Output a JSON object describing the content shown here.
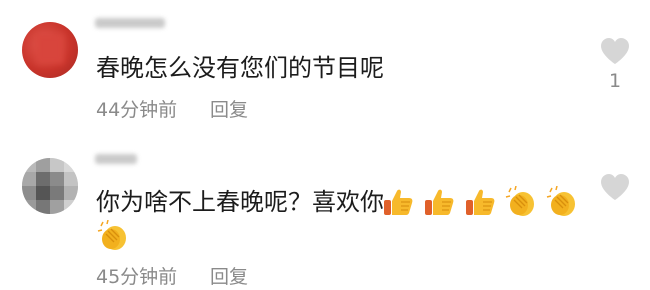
{
  "comments": [
    {
      "text": "春晚怎么没有您们的节目呢",
      "time": "44分钟前",
      "reply_label": "回复",
      "like_count": "1",
      "emojis": []
    },
    {
      "text": "你为啥不上春晚呢？喜欢你",
      "time": "45分钟前",
      "reply_label": "回复",
      "like_count": "",
      "emojis": [
        "thumbs-up",
        "thumbs-up",
        "thumbs-up",
        "clapping-hands",
        "clapping-hands",
        "clapping-hands"
      ]
    }
  ],
  "colors": {
    "meta_text": "#8a8a8a",
    "heart_icon": "#d6d6d6",
    "avatar_red": "#c9342b"
  }
}
